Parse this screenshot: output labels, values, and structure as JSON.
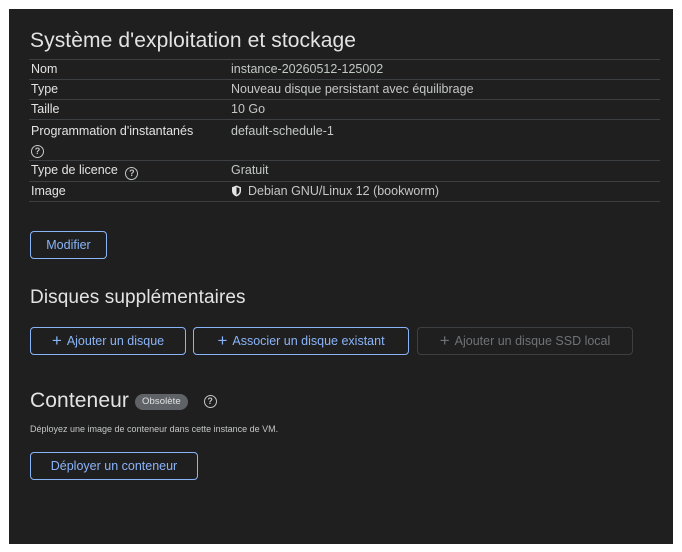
{
  "os_section": {
    "title": "Système d'exploitation et stockage",
    "rows": [
      {
        "key": "Nom",
        "value": "instance-20260512-125002"
      },
      {
        "key": "Type",
        "value": "Nouveau disque persistant avec équilibrage"
      },
      {
        "key": "Taille",
        "value": "10 Go"
      },
      {
        "key": "Programmation d'instantanés",
        "value": "default-schedule-1"
      },
      {
        "key": "Type de licence",
        "value": "Gratuit"
      },
      {
        "key": "Image",
        "value": "Debian GNU/Linux 12 (bookworm)"
      }
    ],
    "modify_label": "Modifier"
  },
  "disks_section": {
    "title": "Disques supplémentaires",
    "add_disk_label": "Ajouter un disque",
    "attach_disk_label": "Associer un disque existant",
    "add_ssd_label": "Ajouter un disque SSD local"
  },
  "container_section": {
    "title": "Conteneur",
    "badge": "Obsolète",
    "description": "Déployez une image de conteneur dans cette instance de VM.",
    "deploy_label": "Déployer un conteneur"
  },
  "icons": {
    "help": "help-circle-icon",
    "image": "shield-icon",
    "add": "plus-icon"
  },
  "colors": {
    "background": "#1f1f1f",
    "accent": "#8ab4f8",
    "text": "#e3e3e3",
    "muted": "#c4c7c5",
    "divider": "#3c4043"
  }
}
